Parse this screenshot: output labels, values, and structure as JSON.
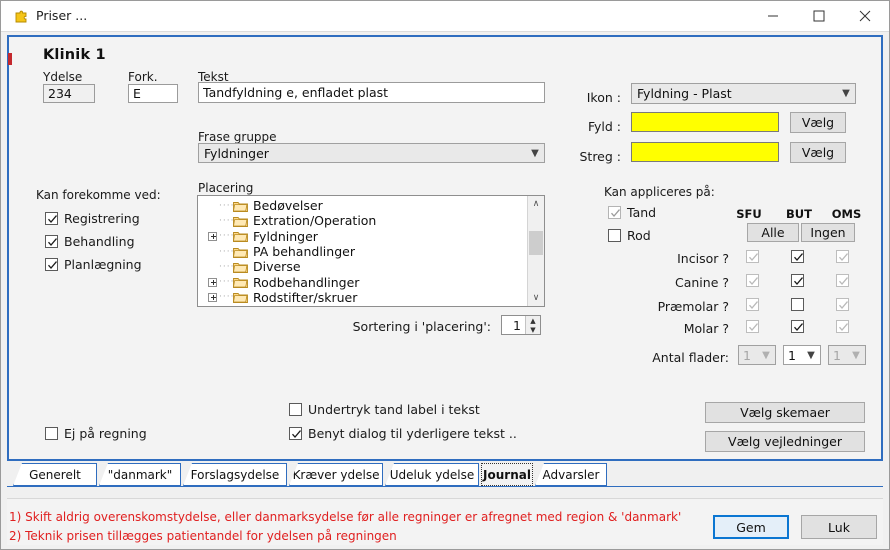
{
  "window": {
    "title": "Priser ...",
    "icon": "app-puzzle-icon",
    "minimize": "—",
    "maximize": "□",
    "close": "✕"
  },
  "clinic": {
    "title": "Klinik 1"
  },
  "fields": {
    "ydelse_label": "Ydelse",
    "ydelse_value": "234",
    "fork_label": "Fork.",
    "fork_value": "E",
    "tekst_label": "Tekst",
    "tekst_value": "Tandfyldning e, enfladet plast",
    "frase_label": "Frase gruppe",
    "frase_value": "Fyldninger"
  },
  "occurrence": {
    "title": "Kan forekomme ved:",
    "items": [
      {
        "label": "Registrering",
        "checked": true
      },
      {
        "label": "Behandling",
        "checked": true
      },
      {
        "label": "Planlægning",
        "checked": true
      }
    ]
  },
  "placement": {
    "label": "Placering",
    "items": [
      {
        "label": "Bedøvelser",
        "expandable": false
      },
      {
        "label": "Extration/Operation",
        "expandable": false
      },
      {
        "label": "Fyldninger",
        "expandable": true
      },
      {
        "label": "PA behandlinger",
        "expandable": false
      },
      {
        "label": "Diverse",
        "expandable": false
      },
      {
        "label": "Rodbehandlinger",
        "expandable": true
      },
      {
        "label": "Rodstifter/skruer",
        "expandable": true
      }
    ],
    "scroll_up": "∧",
    "scroll_down": "∨"
  },
  "sorting": {
    "label": "Sortering i 'placering':",
    "value": "1",
    "up": "▲",
    "down": "▼"
  },
  "icon_section": {
    "ikon_label": "Ikon :",
    "ikon_value": "Fyldning - Plast",
    "fyld_label": "Fyld :",
    "fyld_color": "#ffff00",
    "fyld_button": "Vælg",
    "streg_label": "Streg :",
    "streg_color": "#ffff00",
    "streg_button": "Vælg"
  },
  "apply": {
    "title": "Kan appliceres på:",
    "tand_label": "Tand",
    "tand_checked": true,
    "tand_disabled": true,
    "rod_label": "Rod",
    "rod_checked": false,
    "columns": [
      "SFU",
      "BUT",
      "OMS"
    ],
    "alle_button": "Alle",
    "ingen_button": "Ingen",
    "rows": [
      {
        "label": "Incisor ?",
        "sfu": true,
        "sfu_disabled": true,
        "but": true,
        "oms": true,
        "oms_disabled": true
      },
      {
        "label": "Canine ?",
        "sfu": true,
        "sfu_disabled": true,
        "but": true,
        "oms": true,
        "oms_disabled": true
      },
      {
        "label": "Præmolar ?",
        "sfu": true,
        "sfu_disabled": true,
        "but": false,
        "oms": true,
        "oms_disabled": true
      },
      {
        "label": "Molar ?",
        "sfu": true,
        "sfu_disabled": true,
        "but": true,
        "oms": true,
        "oms_disabled": true
      }
    ],
    "flader_label": "Antal flader:",
    "flader_values": [
      "1",
      "1",
      "1"
    ],
    "flader_disabled": [
      true,
      false,
      true
    ]
  },
  "options": {
    "ej_pa_regning": "Ej på regning",
    "ej_pa_regning_checked": false,
    "undertryk": "Undertryk tand label i tekst",
    "undertryk_checked": false,
    "benyt_dialog": "Benyt dialog til yderligere tekst ..",
    "benyt_dialog_checked": true
  },
  "side_buttons": {
    "skemaer": "Vælg skemaer",
    "vejledninger": "Vælg vejledninger"
  },
  "tabs": [
    {
      "label": "Generelt",
      "active": false
    },
    {
      "label": "\"danmark\"",
      "active": false
    },
    {
      "label": "Forslagsydelse",
      "active": false
    },
    {
      "label": "Kræver ydelse",
      "active": false
    },
    {
      "label": "Udeluk ydelse",
      "active": false
    },
    {
      "label": "Journal",
      "active": true
    },
    {
      "label": "Advarsler",
      "active": false
    }
  ],
  "warnings": [
    "1) Skift aldrig overenskomstydelse, eller danmarksydelse før alle regninger er afregnet med region & 'danmark'",
    "2) Teknik prisen tillægges patientandel for ydelsen på regningen"
  ],
  "footer": {
    "save": "Gem",
    "close": "Luk"
  },
  "colors": {
    "accent": "#2f6dbf",
    "warning": "#e02020",
    "swatch": "#ffff00",
    "focus": "#0a76d2"
  }
}
